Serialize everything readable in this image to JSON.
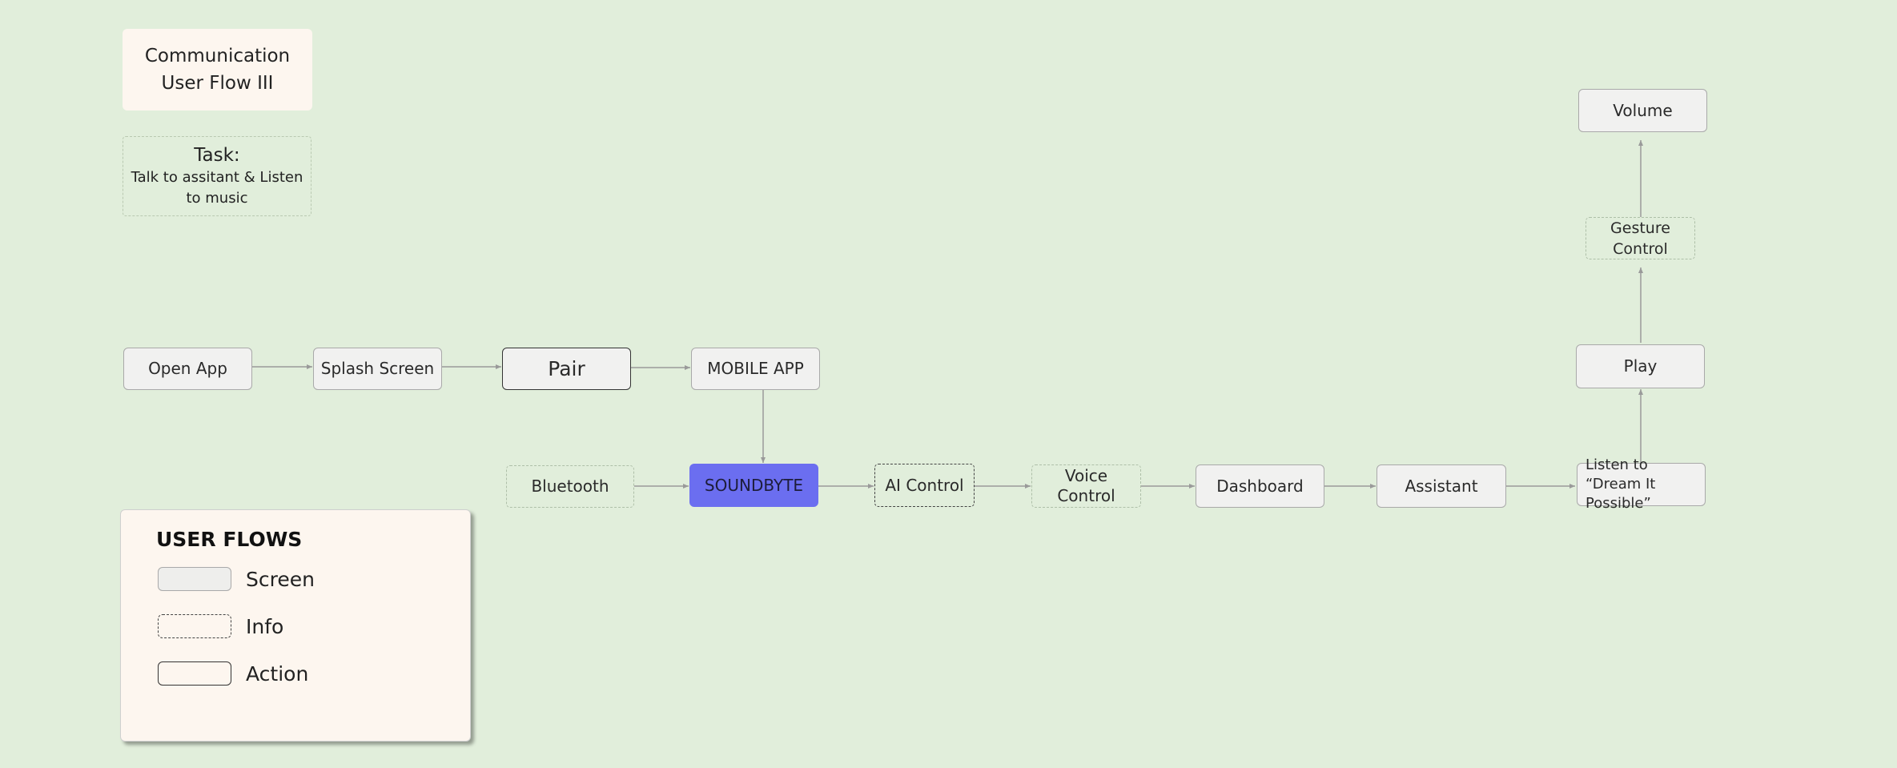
{
  "title": {
    "line1": "Communication",
    "line2": "User Flow III"
  },
  "task": {
    "heading": "Task:",
    "text": "Talk to assitant & Listen to music"
  },
  "nodes": {
    "open_app": "Open App",
    "splash_screen": "Splash Screen",
    "pair": "Pair",
    "mobile_app": "MOBILE APP",
    "bluetooth": "Bluetooth",
    "soundbyte": "SOUNDBYTE",
    "ai_control": "AI Control",
    "voice_control": "Voice Control",
    "dashboard": "Dashboard",
    "assistant": "Assistant",
    "listen": "Listen to “Dream It Possible”",
    "play": "Play",
    "gesture_control": "Gesture Control",
    "volume": "Volume"
  },
  "legend": {
    "title": "USER FLOWS",
    "screen": "Screen",
    "info": "Info",
    "action": "Action"
  },
  "colors": {
    "background": "#e1eedb",
    "card": "#fdf6ef",
    "screen_fill": "#f1f1f0",
    "highlight": "#6b6ef0",
    "edge": "#9a9a9a"
  }
}
